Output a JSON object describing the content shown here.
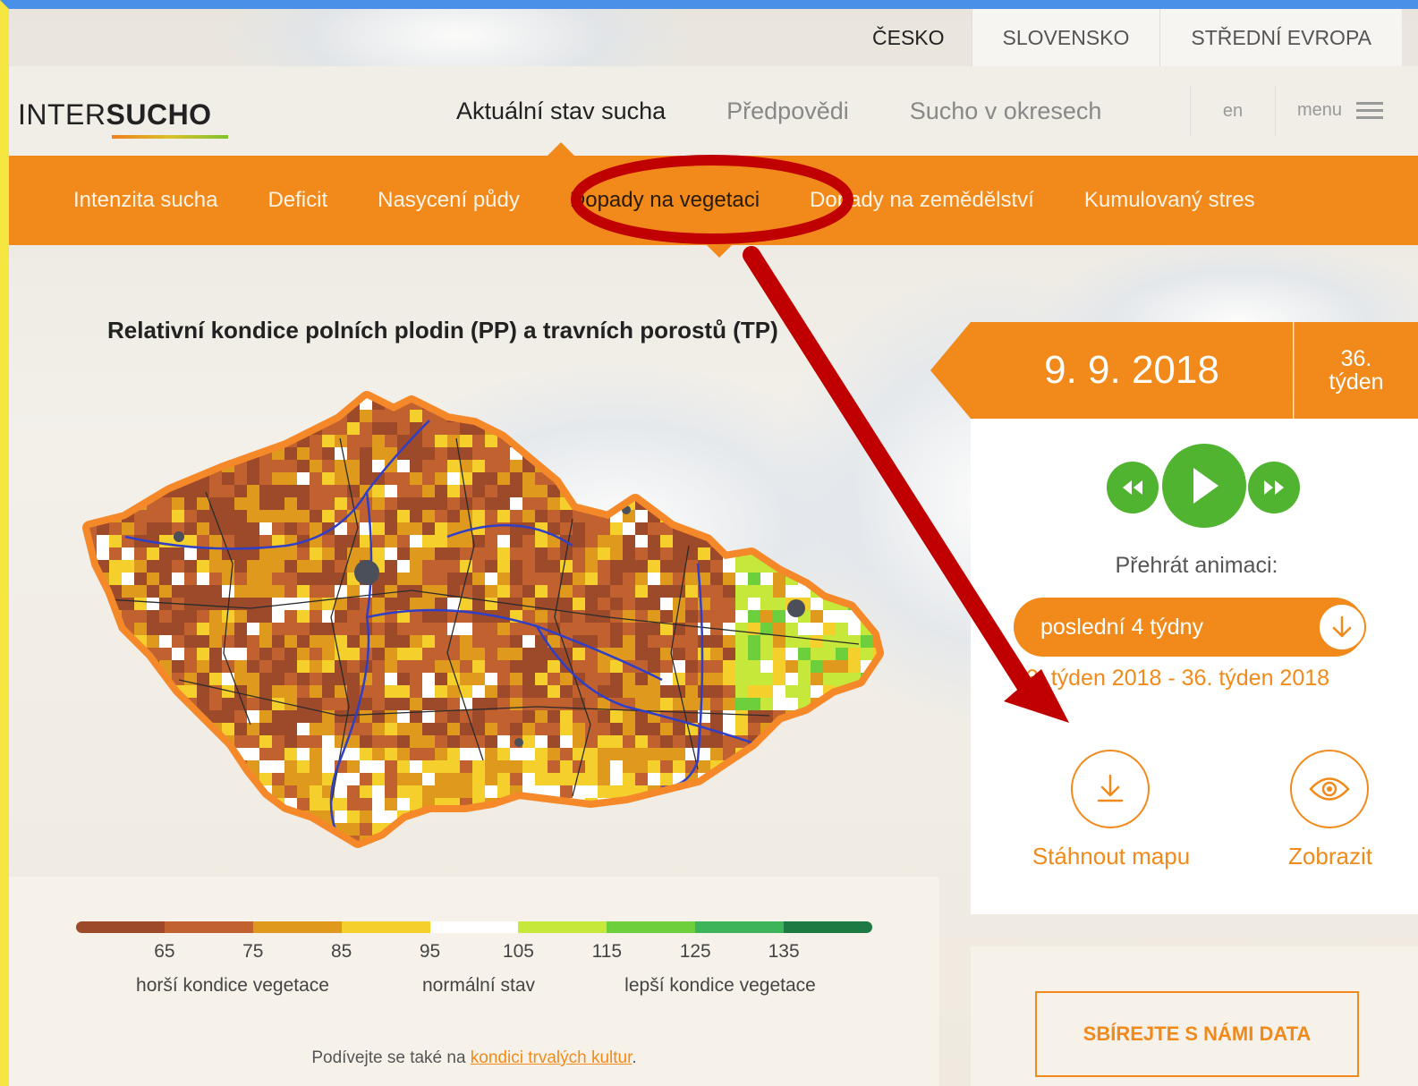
{
  "region_tabs": [
    {
      "label": "ČESKO",
      "active": true
    },
    {
      "label": "SLOVENSKO",
      "active": false
    },
    {
      "label": "STŘEDNÍ EVROPA",
      "active": false
    }
  ],
  "logo": {
    "part1": "INTER",
    "part2": "SUCHO"
  },
  "main_nav": [
    {
      "label": "Aktuální stav sucha",
      "active": true
    },
    {
      "label": "Předpovědi",
      "active": false
    },
    {
      "label": "Sucho v okresech",
      "active": false
    }
  ],
  "lang": "en",
  "menu_label": "menu",
  "sub_nav": [
    {
      "label": "Intenzita sucha",
      "active": false
    },
    {
      "label": "Deficit",
      "active": false
    },
    {
      "label": "Nasycení půdy",
      "active": false
    },
    {
      "label": "Dopady na vegetaci",
      "active": true
    },
    {
      "label": "Dopady na zemědělství",
      "active": false
    },
    {
      "label": "Kumulovaný stres",
      "active": false
    }
  ],
  "map": {
    "title": "Relativní kondice polních plodin (PP) a travních porostů (TP)"
  },
  "legend": {
    "colors": [
      "#9c4a2a",
      "#c0612f",
      "#df9a1e",
      "#f5cf2c",
      "#ffffff",
      "#c6e83a",
      "#6ccf3b",
      "#3db459",
      "#1e7a43"
    ],
    "ticks": [
      "65",
      "75",
      "85",
      "95",
      "105",
      "115",
      "125",
      "135"
    ],
    "captions": [
      "horší kondice vegetace",
      "normální stav",
      "lepší kondice vegetace"
    ],
    "also_prefix": "Podívejte se také na ",
    "also_link": "kondici trvalých kultur",
    "also_suffix": "."
  },
  "date_panel": {
    "date": "9. 9. 2018",
    "week_num": "36.",
    "week_word": "týden",
    "anim_label": "Přehrát animaci:",
    "anim_option": "poslední 4 týdny",
    "range": "33. týden 2018 - 36. týden 2018",
    "download_label": "Stáhnout mapu",
    "view_label": "Zobrazit"
  },
  "collect_button": "SBÍREJTE S NÁMI DATA",
  "colors": {
    "accent": "#f18a1a",
    "play_green": "#50b431",
    "annotation_red": "#c00000"
  }
}
